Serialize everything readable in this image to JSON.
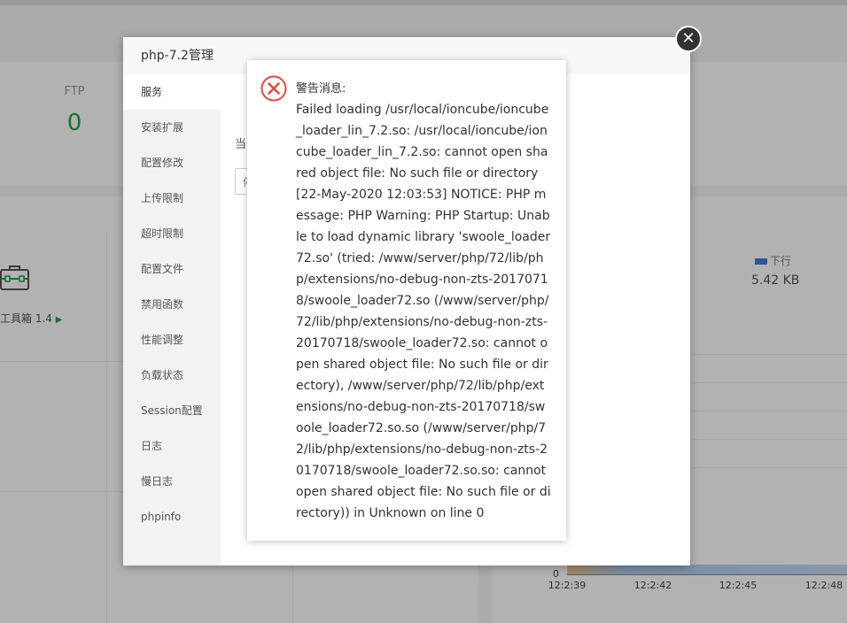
{
  "background": {
    "stat": {
      "label": "FTP",
      "value": "0"
    },
    "toolbox": {
      "label": "工具箱 1.4"
    },
    "network": {
      "legend_label": "下行",
      "legend_value": "5.42 KB",
      "legend_color": "#3d7fd8"
    },
    "chart": {
      "zero_label": "0",
      "x_ticks": [
        "12:2:39",
        "12:2:42",
        "12:2:45",
        "12:2:48"
      ]
    }
  },
  "php_dialog": {
    "title": "php-7.2管理",
    "menu": [
      {
        "label": "服务",
        "active": true
      },
      {
        "label": "安装扩展"
      },
      {
        "label": "配置修改"
      },
      {
        "label": "上传限制"
      },
      {
        "label": "超时限制"
      },
      {
        "label": "配置文件"
      },
      {
        "label": "禁用函数"
      },
      {
        "label": "性能调整"
      },
      {
        "label": "负载状态"
      },
      {
        "label": "Session配置"
      },
      {
        "label": "日志"
      },
      {
        "label": "慢日志"
      },
      {
        "label": "phpinfo"
      }
    ],
    "content_label": "当",
    "content_button": "停",
    "close_symbol": "✕"
  },
  "alert": {
    "icon": "error-circle-icon",
    "icon_color": "#e8483f",
    "title": "警告消息:",
    "message": "Failed loading /usr/local/ioncube/ioncube_loader_lin_7.2.so: /usr/local/ioncube/ioncube_loader_lin_7.2.so: cannot open shared object file: No such file or directory [22-May-2020 12:03:53] NOTICE: PHP message: PHP Warning: PHP Startup: Unable to load dynamic library 'swoole_loader72.so' (tried: /www/server/php/72/lib/php/extensions/no-debug-non-zts-20170718/swoole_loader72.so (/www/server/php/72/lib/php/extensions/no-debug-non-zts-20170718/swoole_loader72.so: cannot open shared object file: No such file or directory), /www/server/php/72/lib/php/extensions/no-debug-non-zts-20170718/swoole_loader72.so.so (/www/server/php/72/lib/php/extensions/no-debug-non-zts-20170718/swoole_loader72.so.so: cannot open shared object file: No such file or directory)) in Unknown on line 0"
  }
}
